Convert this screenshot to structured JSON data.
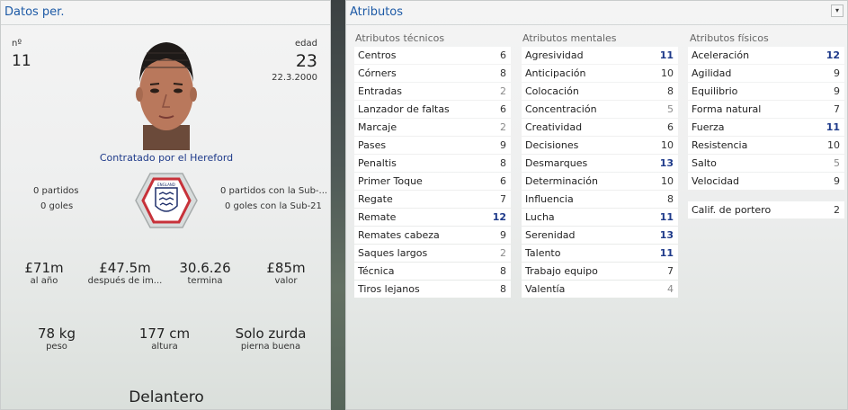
{
  "left_panel": {
    "title": "Datos per.",
    "number_label": "nº",
    "number": "11",
    "age_label": "edad",
    "age": "23",
    "birthdate": "22.3.2000",
    "contract_text": "Contratado por el Hereford",
    "caps": "0 partidos",
    "goals": "0 goles",
    "u21_caps": "0 partidos con la Sub-...",
    "u21_goals": "0 goles con la Sub-21",
    "badge_text": "ENGLAND",
    "stats": [
      {
        "value": "£71m",
        "label": "al año"
      },
      {
        "value": "£47.5m",
        "label": "después de im..."
      },
      {
        "value": "30.6.26",
        "label": "termina"
      },
      {
        "value": "£85m",
        "label": "valor"
      }
    ],
    "physical": [
      {
        "value": "78 kg",
        "label": "peso"
      },
      {
        "value": "177 cm",
        "label": "altura"
      },
      {
        "value": "Solo zurda",
        "label": "pierna buena"
      }
    ],
    "position": "Delantero"
  },
  "right_panel": {
    "title": "Atributos",
    "menu_icon": "chevron-down-icon",
    "technical": {
      "header": "Atributos técnicos",
      "items": [
        {
          "name": "Centros",
          "value": "6",
          "tone": "dark"
        },
        {
          "name": "Córners",
          "value": "8",
          "tone": "dark"
        },
        {
          "name": "Entradas",
          "value": "2",
          "tone": "grey"
        },
        {
          "name": "Lanzador de faltas",
          "value": "6",
          "tone": "dark"
        },
        {
          "name": "Marcaje",
          "value": "2",
          "tone": "grey"
        },
        {
          "name": "Pases",
          "value": "9",
          "tone": "dark"
        },
        {
          "name": "Penaltis",
          "value": "8",
          "tone": "dark"
        },
        {
          "name": "Primer Toque",
          "value": "6",
          "tone": "dark"
        },
        {
          "name": "Regate",
          "value": "7",
          "tone": "dark"
        },
        {
          "name": "Remate",
          "value": "12",
          "tone": "blue"
        },
        {
          "name": "Remates cabeza",
          "value": "9",
          "tone": "dark"
        },
        {
          "name": "Saques largos",
          "value": "2",
          "tone": "grey"
        },
        {
          "name": "Técnica",
          "value": "8",
          "tone": "dark"
        },
        {
          "name": "Tiros lejanos",
          "value": "8",
          "tone": "dark"
        }
      ]
    },
    "mental": {
      "header": "Atributos mentales",
      "items": [
        {
          "name": "Agresividad",
          "value": "11",
          "tone": "blue"
        },
        {
          "name": "Anticipación",
          "value": "10",
          "tone": "dark"
        },
        {
          "name": "Colocación",
          "value": "8",
          "tone": "dark"
        },
        {
          "name": "Concentración",
          "value": "5",
          "tone": "grey"
        },
        {
          "name": "Creatividad",
          "value": "6",
          "tone": "dark"
        },
        {
          "name": "Decisiones",
          "value": "10",
          "tone": "dark"
        },
        {
          "name": "Desmarques",
          "value": "13",
          "tone": "blue"
        },
        {
          "name": "Determinación",
          "value": "10",
          "tone": "dark"
        },
        {
          "name": "Influencia",
          "value": "8",
          "tone": "dark"
        },
        {
          "name": "Lucha",
          "value": "11",
          "tone": "blue"
        },
        {
          "name": "Serenidad",
          "value": "13",
          "tone": "blue"
        },
        {
          "name": "Talento",
          "value": "11",
          "tone": "blue"
        },
        {
          "name": "Trabajo equipo",
          "value": "7",
          "tone": "dark"
        },
        {
          "name": "Valentía",
          "value": "4",
          "tone": "grey"
        }
      ]
    },
    "physical": {
      "header": "Atributos físicos",
      "items": [
        {
          "name": "Aceleración",
          "value": "12",
          "tone": "blue"
        },
        {
          "name": "Agilidad",
          "value": "9",
          "tone": "dark"
        },
        {
          "name": "Equilibrio",
          "value": "9",
          "tone": "dark"
        },
        {
          "name": "Forma natural",
          "value": "7",
          "tone": "dark"
        },
        {
          "name": "Fuerza",
          "value": "11",
          "tone": "blue"
        },
        {
          "name": "Resistencia",
          "value": "10",
          "tone": "dark"
        },
        {
          "name": "Salto",
          "value": "5",
          "tone": "grey"
        },
        {
          "name": "Velocidad",
          "value": "9",
          "tone": "dark"
        }
      ],
      "goalkeeper": {
        "name": "Calif. de portero",
        "value": "2",
        "tone": "dark"
      }
    }
  }
}
